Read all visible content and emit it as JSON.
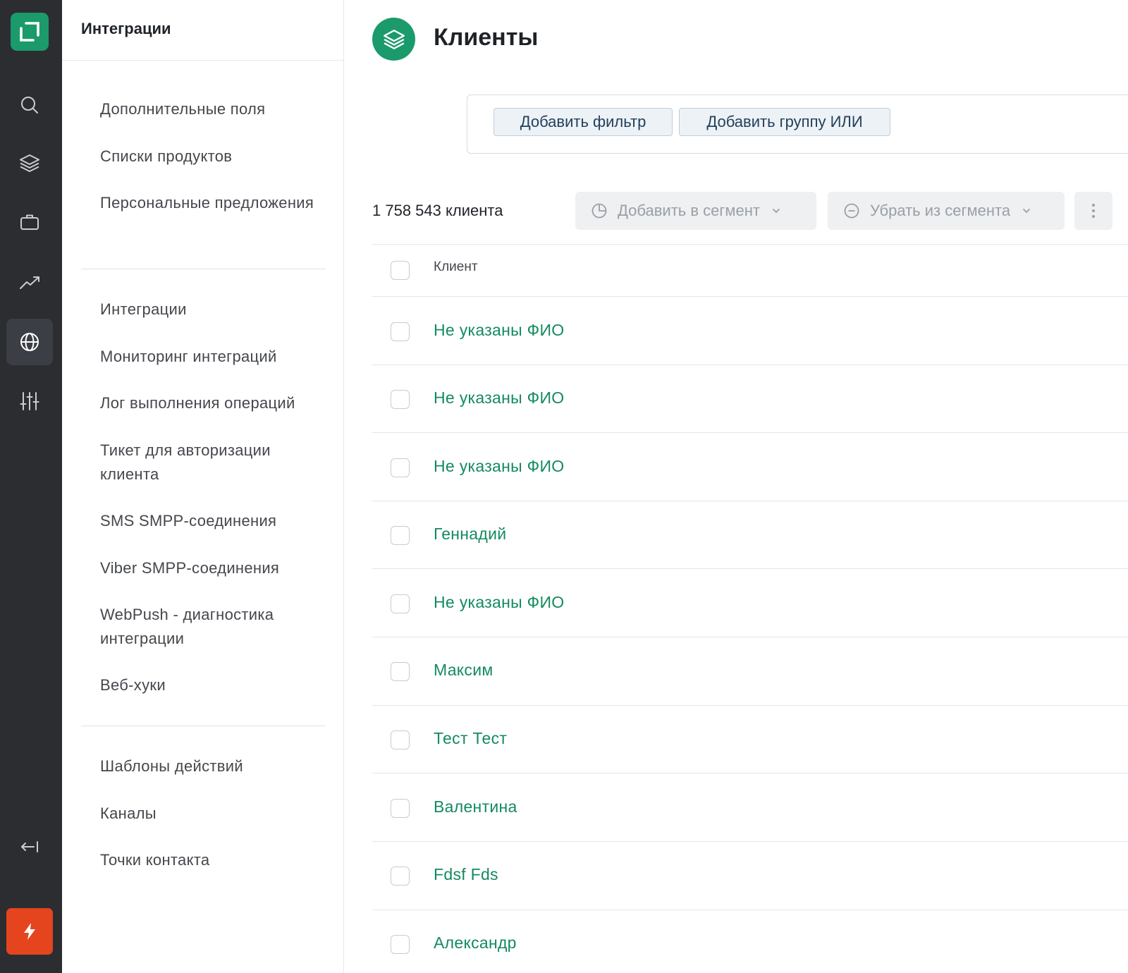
{
  "colors": {
    "rail_bg": "#2b2d31",
    "brand_green": "#1b9a6c",
    "link_green": "#148a5e",
    "bolt_orange": "#e4451f"
  },
  "rail": {
    "logo_icon": "logo-icon",
    "items": [
      {
        "icon": "search-icon",
        "active": false
      },
      {
        "icon": "layers-icon",
        "active": false
      },
      {
        "icon": "briefcase-icon",
        "active": false
      },
      {
        "icon": "trend-up-icon",
        "active": false
      },
      {
        "icon": "globe-icon",
        "active": true
      },
      {
        "icon": "sliders-icon",
        "active": false
      }
    ],
    "collapse_icon": "collapse-left-icon",
    "bolt_icon": "bolt-icon"
  },
  "subnav": {
    "title": "Интеграции",
    "groups": [
      [
        "Дополнительные поля",
        "Списки продуктов",
        "Персональные предложения"
      ],
      [
        "Интеграции",
        "Мониторинг интеграций",
        "Лог выполнения операций",
        "Тикет для авторизации клиента",
        "SMS SMPP-соединения",
        "Viber SMPP-соединения",
        "WebPush - диагностика интеграции",
        "Веб-хуки"
      ],
      [
        "Шаблоны действий",
        "Каналы",
        "Точки контакта"
      ]
    ]
  },
  "page": {
    "icon": "layers-icon",
    "title": "Клиенты"
  },
  "filters": {
    "add_filter": "Добавить фильтр",
    "add_or_group": "Добавить группу ИЛИ"
  },
  "toolbar": {
    "count": "1 758 543 клиента",
    "add_to_segment": "Добавить в сегмент",
    "remove_from_segment": "Убрать из сегмента",
    "more_icon": "more-vertical-icon"
  },
  "table": {
    "header": "Клиент",
    "rows": [
      "Не указаны ФИО",
      "Не указаны ФИО",
      "Не указаны ФИО",
      "Геннадий",
      "Не указаны ФИО",
      "Максим",
      "Тест Тест",
      "Валентина",
      "Fdsf Fds",
      "Александр"
    ]
  }
}
